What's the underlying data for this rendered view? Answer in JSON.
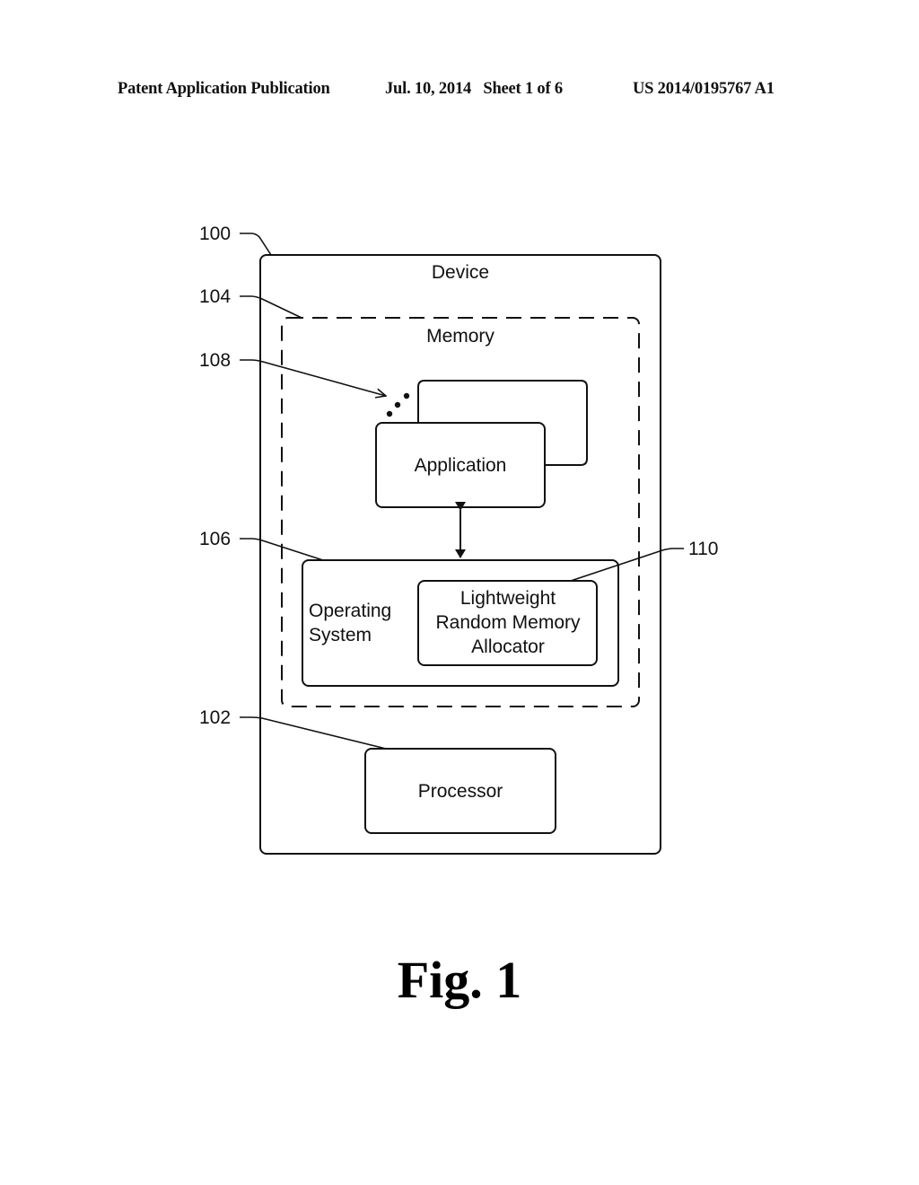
{
  "header": {
    "publication": "Patent Application Publication",
    "date_sheet": "Jul. 10, 2014   Sheet 1 of 6",
    "patent_number": "US 2014/0195767 A1"
  },
  "diagram": {
    "device": {
      "label": "Device",
      "ref": "100"
    },
    "memory": {
      "label": "Memory",
      "ref": "104"
    },
    "applications": {
      "label": "Application",
      "ref": "108"
    },
    "operating_system": {
      "label_line1": "Operating",
      "label_line2": "System",
      "ref": "106"
    },
    "allocator": {
      "label_line1": "Lightweight",
      "label_line2": "Random Memory",
      "label_line3": "Allocator",
      "ref": "110"
    },
    "processor": {
      "label": "Processor",
      "ref": "102"
    }
  },
  "figure_label": "Fig. 1"
}
